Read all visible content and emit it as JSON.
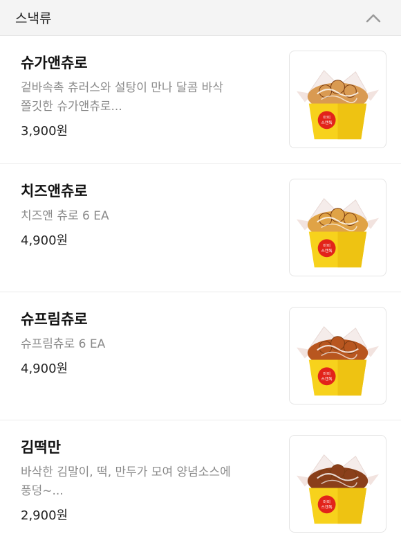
{
  "section": {
    "title": "스낵류",
    "collapse_icon": "chevron-up-icon"
  },
  "items": [
    {
      "name": "슈가앤츄로",
      "description_line1": "겉바속촉 츄러스와 설탕이 만나 달콤 바삭",
      "description_line2": "쫄깃한 슈가앤츄로...",
      "price": "3,900원",
      "image_icon": "sugar-churro-box-image",
      "food_color": "#d99a52",
      "box_label_line1": "아이",
      "box_label_line2": "스캔톡"
    },
    {
      "name": "치즈앤츄로",
      "description_line1": "치즈앤 츄로 6 EA",
      "description_line2": "",
      "price": "4,900원",
      "image_icon": "cheese-churro-box-image",
      "food_color": "#e0a346",
      "box_label_line1": "아이",
      "box_label_line2": "스캔톡"
    },
    {
      "name": "슈프림츄로",
      "description_line1": "슈프림츄로 6 EA",
      "description_line2": "",
      "price": "4,900원",
      "image_icon": "supreme-churro-box-image",
      "food_color": "#b8561f",
      "box_label_line1": "아이",
      "box_label_line2": "스캔톡"
    },
    {
      "name": "김떡만",
      "description_line1": "바삭한 김말이, 떡, 만두가 모여 양념소스에",
      "description_line2": "풍덩~...",
      "price": "2,900원",
      "image_icon": "kimtteokman-box-image",
      "food_color": "#8a3f1a",
      "box_label_line1": "아이",
      "box_label_line2": "스캔톡"
    }
  ],
  "colors": {
    "box_yellow": "#f7d21c",
    "box_label_red": "#e2231a",
    "header_bg": "#f4f4f4"
  }
}
